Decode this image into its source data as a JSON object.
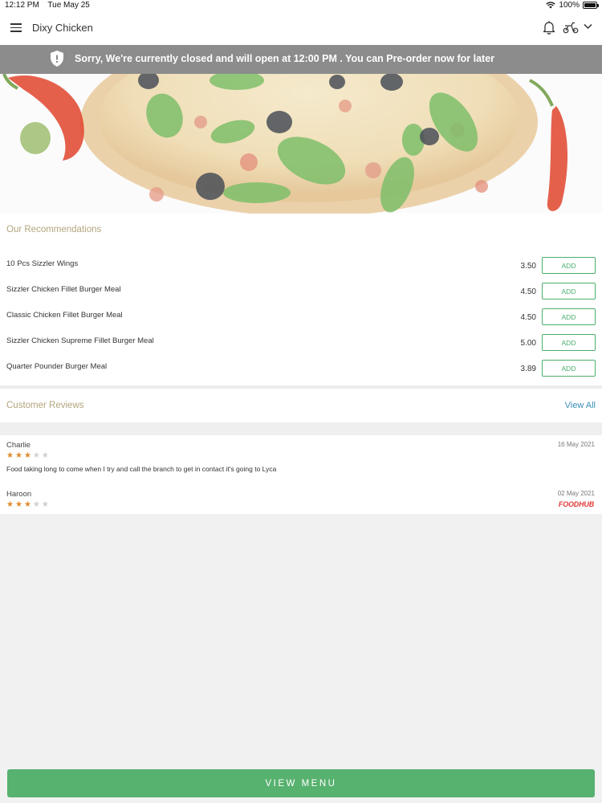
{
  "status_bar": {
    "time": "12:12 PM",
    "date": "Tue May 25",
    "battery": "100%",
    "battery_level": 1.0
  },
  "header": {
    "title": "Dixy Chicken",
    "icons": [
      "menu-icon",
      "bell-icon",
      "scooter-icon",
      "chevron-down-icon"
    ]
  },
  "banner": {
    "text": "Sorry, We're currently closed and will open at 12:00 PM . You can Pre-order now for later",
    "icon": "shield-icon",
    "color": "#8c8c8c"
  },
  "recommendations": {
    "heading": "Our Recommendations",
    "items": [
      {
        "name": "10 Pcs Sizzler Wings",
        "price": "3.50",
        "button": "ADD"
      },
      {
        "name": "Sizzler Chicken Fillet Burger Meal",
        "price": "4.50",
        "button": "ADD"
      },
      {
        "name": "Classic Chicken Fillet Burger Meal",
        "price": "4.50",
        "button": "ADD"
      },
      {
        "name": "Sizzler Chicken Supreme Fillet Burger Meal",
        "price": "5.00",
        "button": "ADD"
      },
      {
        "name": "Quarter Pounder Burger Meal",
        "price": "3.89",
        "button": "ADD"
      }
    ]
  },
  "reviews": {
    "heading": "Customer Reviews",
    "view_all": "View All",
    "items": [
      {
        "name": "Charlie",
        "date": "16 May 2021",
        "rating": 3,
        "max_rating": 5,
        "text": "Food taking long to come when I try and call the branch to get in contact it's going to Lyca",
        "source": ""
      },
      {
        "name": "Haroon",
        "date": "02 May 2021",
        "rating": 3,
        "max_rating": 5,
        "text": "",
        "source": "FOODHUB"
      }
    ]
  },
  "footer": {
    "button": "VIEW MENU",
    "color": "#57b16f"
  }
}
